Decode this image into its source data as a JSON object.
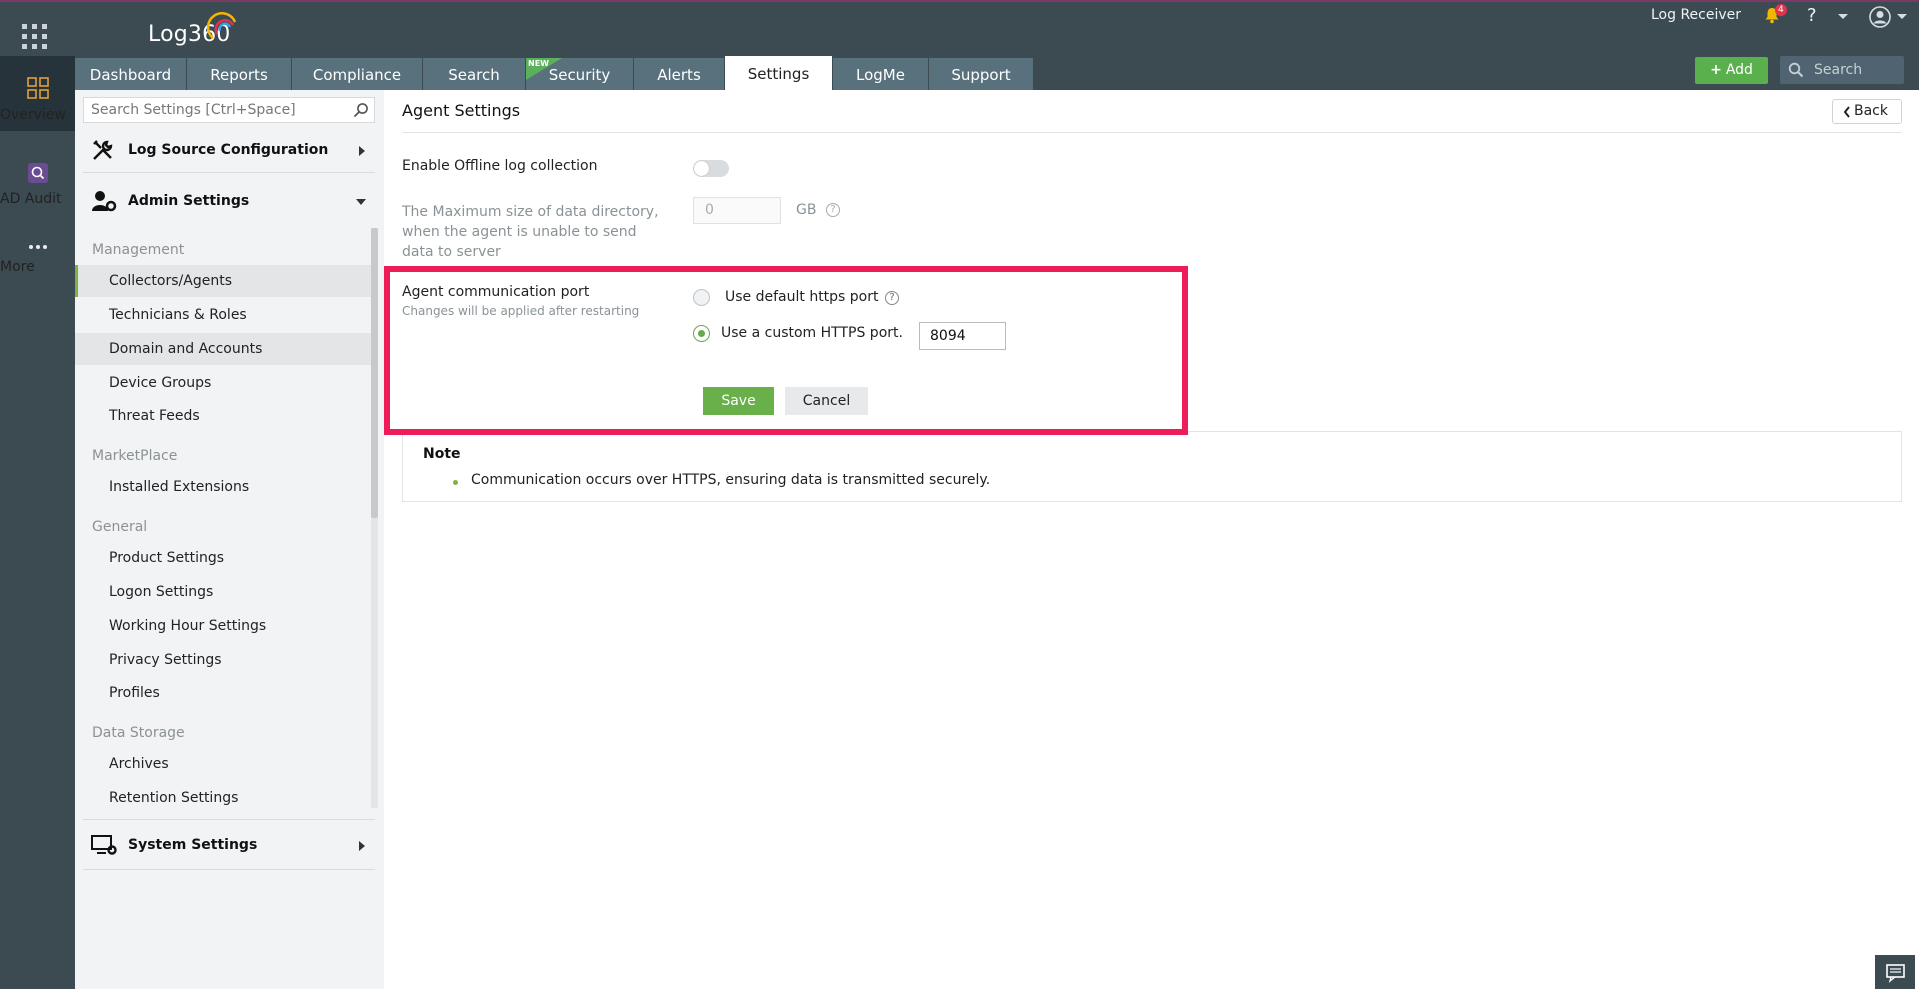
{
  "header": {
    "logo": "Log360",
    "log_receiver": "Log Receiver",
    "notification_count": "4",
    "help": "?",
    "add_button": "Add",
    "search_placeholder": "Search",
    "tabs": [
      {
        "label": "Dashboard",
        "active": false
      },
      {
        "label": "Reports",
        "active": false
      },
      {
        "label": "Compliance",
        "active": false
      },
      {
        "label": "Search",
        "active": false
      },
      {
        "label": "Security",
        "active": false,
        "badge": "NEW"
      },
      {
        "label": "Alerts",
        "active": false
      },
      {
        "label": "Settings",
        "active": true
      },
      {
        "label": "LogMe",
        "active": false
      },
      {
        "label": "Support",
        "active": false
      }
    ]
  },
  "rail": {
    "items": [
      {
        "label": "Overview",
        "icon": "overview-icon",
        "active": true
      },
      {
        "label": "AD Audit",
        "icon": "ad-audit-icon",
        "active": false
      },
      {
        "label": "More",
        "icon": "more-icon",
        "active": false
      }
    ]
  },
  "sidebar": {
    "search_placeholder": "Search Settings [Ctrl+Space]",
    "sections": {
      "log_source": "Log Source Configuration",
      "admin": "Admin Settings",
      "system": "System Settings"
    },
    "groups": {
      "management": "Management",
      "marketplace": "MarketPlace",
      "general": "General",
      "data_storage": "Data Storage"
    },
    "items": {
      "collectors": "Collectors/Agents",
      "technicians": "Technicians & Roles",
      "domain": "Domain and Accounts",
      "device_groups": "Device Groups",
      "threat_feeds": "Threat Feeds",
      "installed_ext": "Installed Extensions",
      "product_settings": "Product Settings",
      "logon_settings": "Logon Settings",
      "working_hour": "Working Hour Settings",
      "privacy": "Privacy Settings",
      "profiles": "Profiles",
      "archives": "Archives",
      "retention": "Retention Settings"
    }
  },
  "main": {
    "title": "Agent Settings",
    "back": "Back",
    "offline_label": "Enable Offline log collection",
    "offline_enabled": false,
    "max_size_label": "The Maximum size of data directory, when the agent is unable to send data to server",
    "max_size_value": "0",
    "max_size_unit": "GB",
    "port_label": "Agent communication port",
    "port_hint": "Changes will be applied after restarting",
    "default_port_option": "Use default https port",
    "custom_port_option": "Use a custom HTTPS port.",
    "custom_port_value": "8094",
    "save": "Save",
    "cancel": "Cancel",
    "note_title": "Note",
    "note_text": "Communication occurs over HTTPS, ensuring data is transmitted securely."
  },
  "colors": {
    "header_bg": "#3c4a52",
    "tab_bg": "#59707d",
    "accent_green": "#6ab04a",
    "highlight": "#ee1d5a"
  }
}
